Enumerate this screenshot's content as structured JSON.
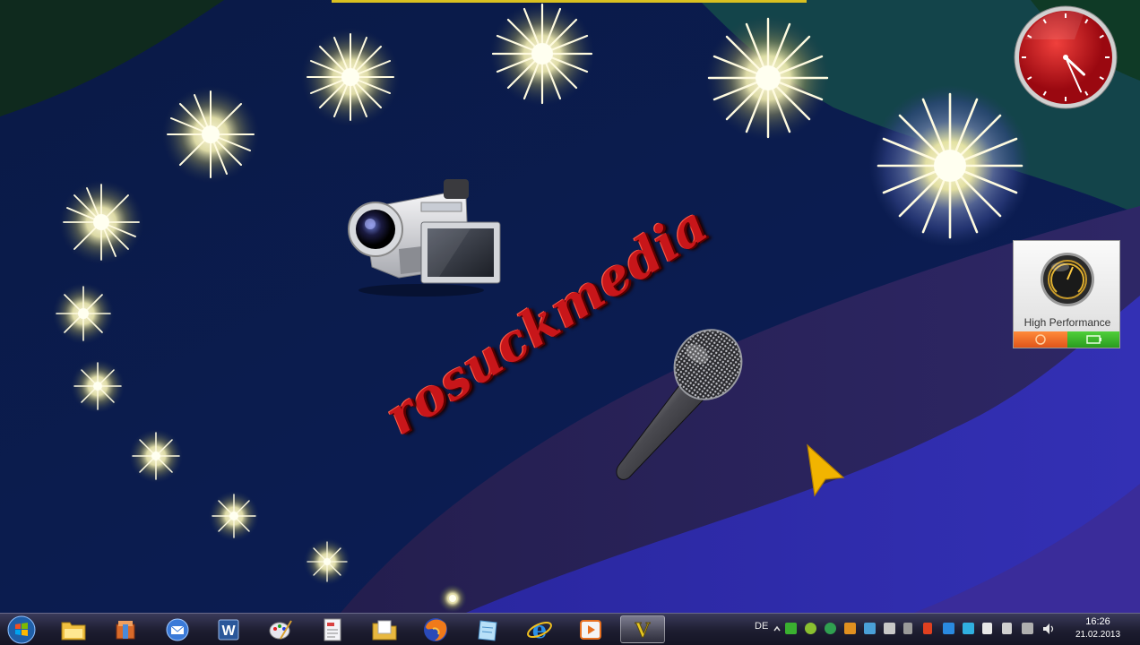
{
  "desktop": {
    "watermark": "rosuckmedia",
    "colors": {
      "sky_top": "#0c1c4e",
      "band_purple": "#2b2460",
      "band_blue": "#2c2aa8",
      "corner_teal": "#134a4e",
      "corner_green": "#103a20",
      "watermark_red": "#c8161a",
      "cursor_yellow": "#f2b400"
    },
    "icons": [
      "camcorder-icon",
      "microphone-icon",
      "mouse-cursor-icon",
      "star-sparkle-icon"
    ]
  },
  "gadgets": {
    "clock": {
      "hours": 16,
      "minutes": 26,
      "color": "#d8141c"
    },
    "power_plan": {
      "label": "High Performance"
    }
  },
  "taskbar": {
    "start": {
      "icon": "windows-start-icon"
    },
    "apps": [
      {
        "name": "explorer",
        "icon": "folder-icon"
      },
      {
        "name": "package",
        "icon": "package-icon"
      },
      {
        "name": "email",
        "icon": "mail-icon"
      },
      {
        "name": "word",
        "icon": "word-icon",
        "text": "W"
      },
      {
        "name": "paint",
        "icon": "paint-icon"
      },
      {
        "name": "document",
        "icon": "document-icon"
      },
      {
        "name": "file",
        "icon": "folder-doc-icon"
      },
      {
        "name": "firefox",
        "icon": "firefox-icon"
      },
      {
        "name": "notepad",
        "icon": "note-icon"
      },
      {
        "name": "internet-explorer",
        "icon": "ie-icon",
        "text": "e"
      },
      {
        "name": "media-player",
        "icon": "play-icon"
      },
      {
        "name": "active-app",
        "icon": "vp-icon",
        "text": "V"
      }
    ],
    "language": "DE",
    "time": "16:26",
    "date": "21.02.2013"
  }
}
